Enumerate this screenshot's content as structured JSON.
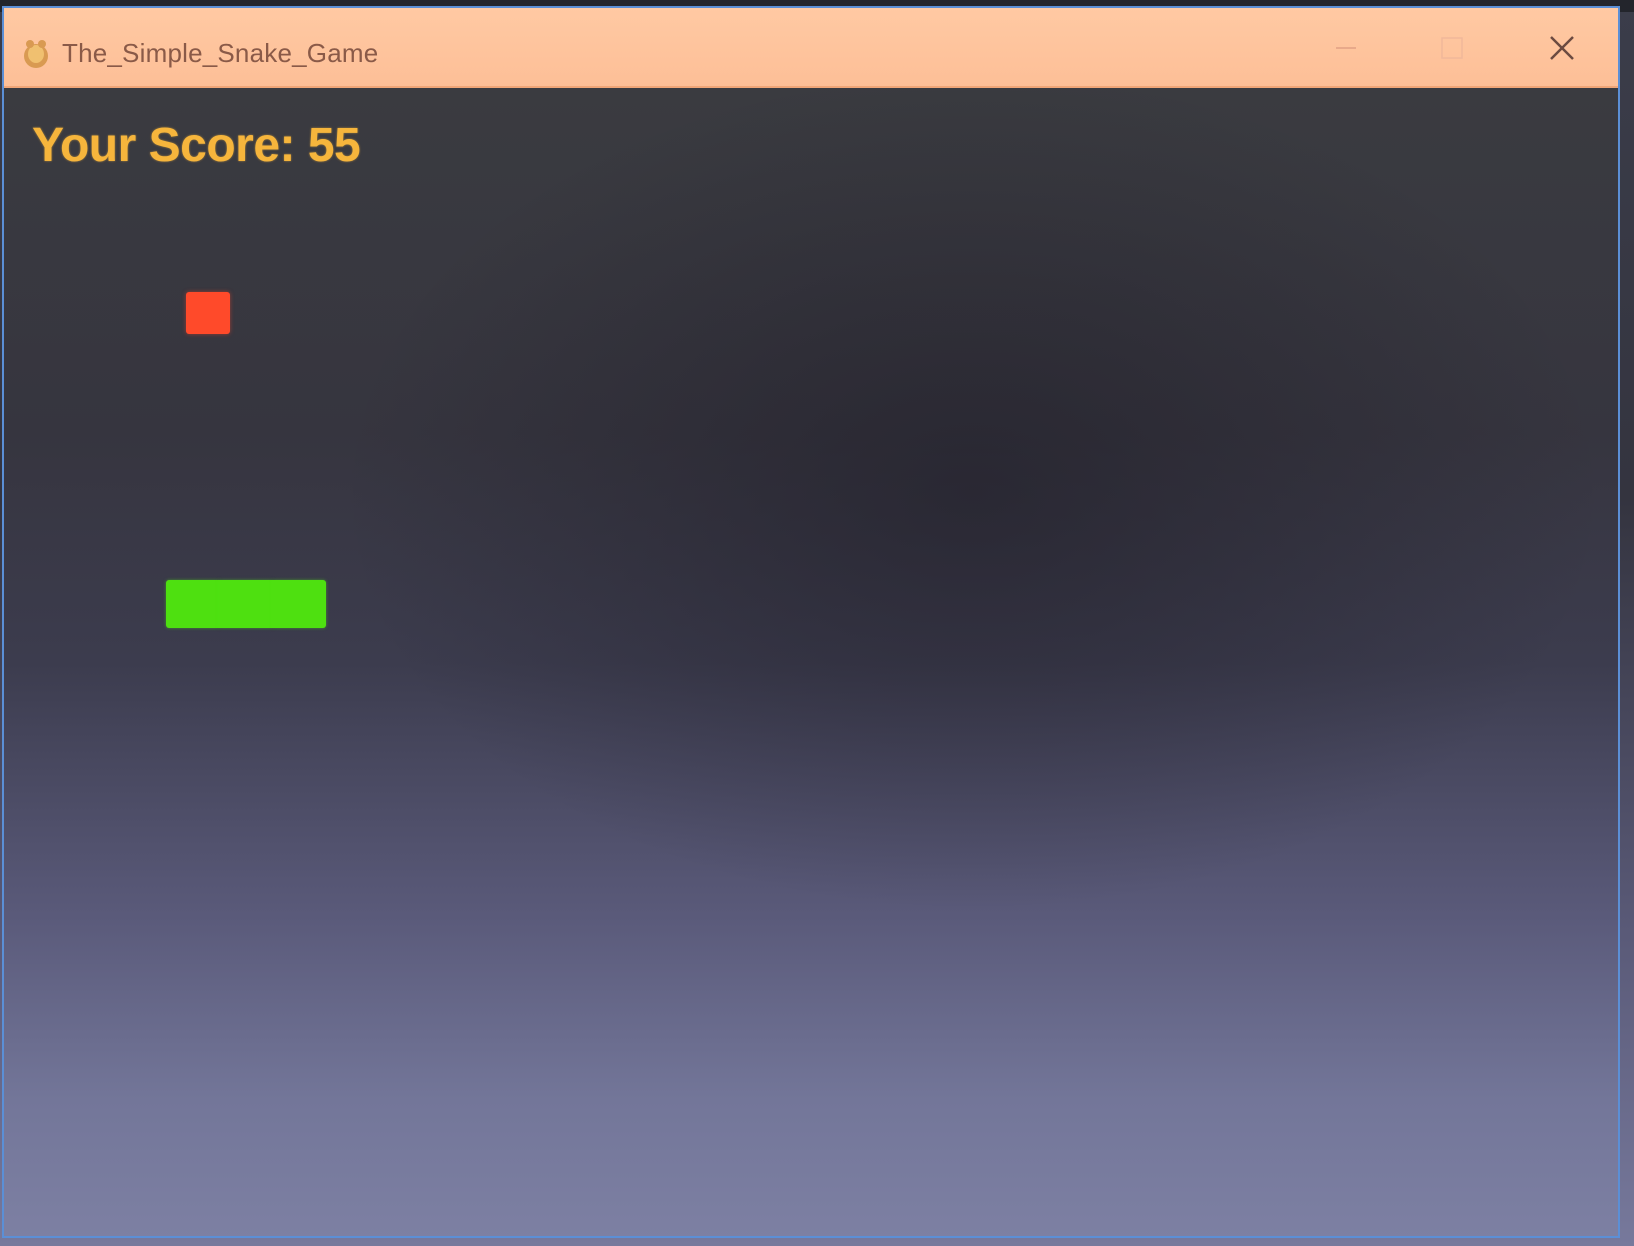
{
  "window": {
    "title": "The_Simple_Snake_Game",
    "icon": "pygame-snake-icon"
  },
  "game": {
    "score_label": "Your Score: 55",
    "score_value": 55,
    "snake_length_segments": 3,
    "colors": {
      "score_text": "#f6b53c",
      "snake": "#4ee010",
      "food": "#ff4a2a",
      "background": "#36373f",
      "titlebar": "#ffc9a3",
      "window_border": "#5b8fd6"
    }
  }
}
